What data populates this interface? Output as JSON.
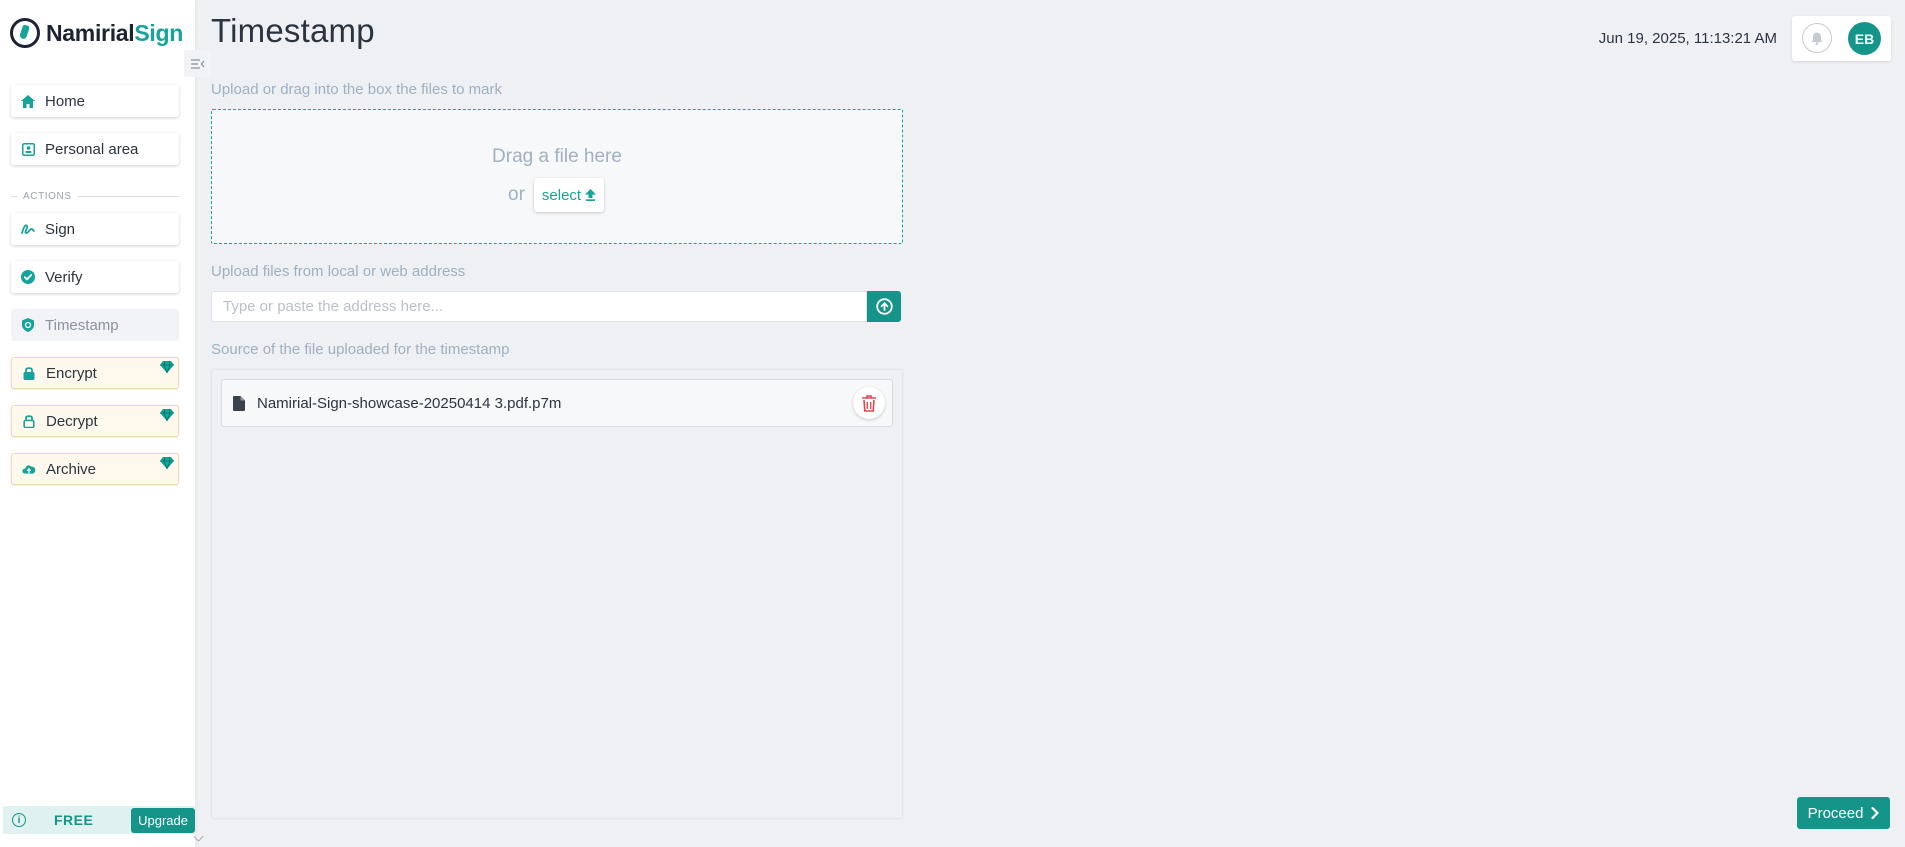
{
  "brand": {
    "name_part1": "Namirial",
    "name_part2": "Sign"
  },
  "sidebar": {
    "items": [
      {
        "label": "Home",
        "icon": "home-icon"
      },
      {
        "label": "Personal area",
        "icon": "id-card-icon"
      }
    ],
    "actions_label": "ACTIONS",
    "actions": [
      {
        "label": "Sign",
        "icon": "signature-icon",
        "premium": false
      },
      {
        "label": "Verify",
        "icon": "verify-badge-icon",
        "premium": false
      },
      {
        "label": "Timestamp",
        "icon": "shield-icon",
        "premium": false,
        "active": true
      },
      {
        "label": "Encrypt",
        "icon": "lock-icon",
        "premium": true
      },
      {
        "label": "Decrypt",
        "icon": "unlock-icon",
        "premium": true
      },
      {
        "label": "Archive",
        "icon": "cloud-upload-icon",
        "premium": true
      }
    ],
    "plan": {
      "name": "FREE",
      "upgrade_label": "Upgrade"
    }
  },
  "header": {
    "title": "Timestamp",
    "datetime": "Jun 19, 2025, 11:13:21 AM",
    "user_initials": "EB"
  },
  "upload": {
    "section_label": "Upload or drag into the box the files to mark",
    "drop_title": "Drag a file here",
    "or_label": "or",
    "select_label": "select"
  },
  "url_upload": {
    "section_label": "Upload files from local or web address",
    "placeholder": "Type or paste the address here...",
    "value": ""
  },
  "files": {
    "section_label": "Source of the file uploaded for the timestamp",
    "items": [
      {
        "name": "Namirial-Sign-showcase-20250414 3.pdf.p7m"
      }
    ]
  },
  "footer": {
    "proceed_label": "Proceed"
  },
  "colors": {
    "accent": "#159489",
    "premium_bg": "#fff8ec",
    "danger": "#e0484f"
  }
}
